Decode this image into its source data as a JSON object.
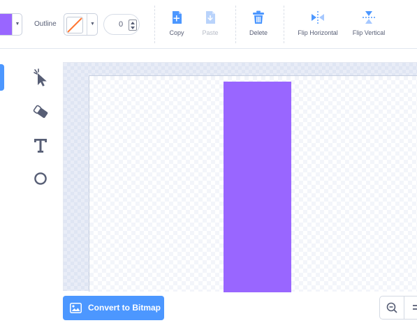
{
  "colors": {
    "fill": "#9966ff",
    "accent": "#4c97ff",
    "outline_none": "#ff7733",
    "text": "#575e75"
  },
  "toolbar": {
    "outline_label": "Outline",
    "stroke_width": "0",
    "copy_label": "Copy",
    "paste_label": "Paste",
    "delete_label": "Delete",
    "flip_horizontal_label": "Flip Horizontal",
    "flip_vertical_label": "Flip Vertical"
  },
  "tools": [
    {
      "name": "select-tool",
      "icon": "select-arrow-icon",
      "active": true
    },
    {
      "name": "eraser-tool",
      "icon": "eraser-icon",
      "active": false
    },
    {
      "name": "text-tool",
      "icon": "text-icon",
      "active": false
    },
    {
      "name": "circle-tool",
      "icon": "circle-icon",
      "active": false
    }
  ],
  "bottom": {
    "convert_label": "Convert to Bitmap",
    "zoom_out_icon": "zoom-out-icon",
    "zoom_reset_icon": "zoom-reset-icon"
  }
}
